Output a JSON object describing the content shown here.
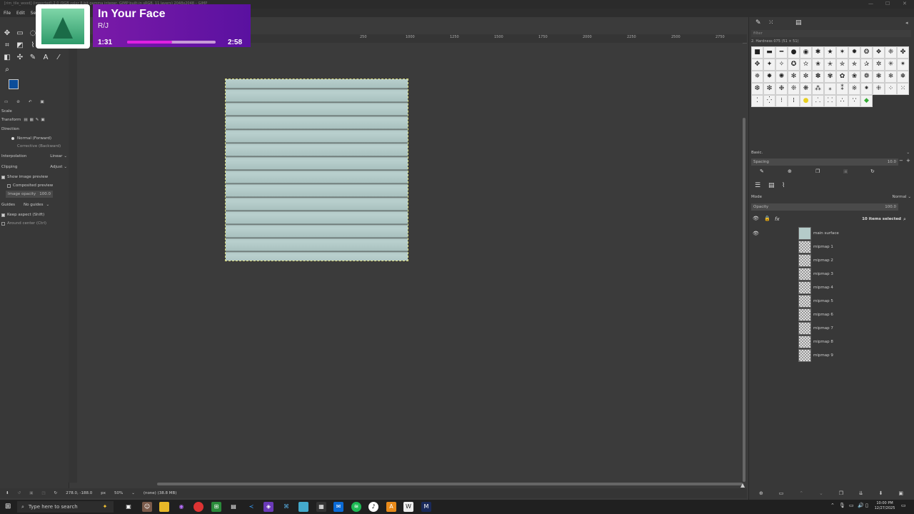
{
  "window": {
    "title": "[rim_tile_wood] (imported)-2.0 (RGB color 8-bit gamma integer, GIMP built-in sRGB, 11 layers) 2048x2048 – GIMP"
  },
  "menu": [
    "File",
    "Edit",
    "Select"
  ],
  "tool_options": {
    "title": "Scale",
    "transform_label": "Transform",
    "direction_label": "Direction",
    "direction_options": [
      "Normal (Forward)",
      "Corrective (Backward)"
    ],
    "interpolation_label": "Interpolation",
    "interpolation_value": "Linear",
    "clipping_label": "Clipping",
    "clipping_value": "Adjust",
    "show_preview": "Show image preview",
    "composited_preview": "Composited preview",
    "image_opacity_label": "Image opacity",
    "image_opacity_value": "100.0",
    "guides_label": "Guides",
    "guides_value": "No guides",
    "keep_aspect": "Keep aspect (Shift)",
    "around_center": "Around center (Ctrl)"
  },
  "status": {
    "coords": "278.0, -188.0",
    "unit": "px",
    "zoom": "50%",
    "info": "(none) (38.8 MB)"
  },
  "ruler_marks": [
    "250",
    "500",
    "750",
    "1000",
    "1250",
    "1500",
    "1750",
    "2000",
    "2250",
    "2500",
    "2750"
  ],
  "brushes": {
    "filter_placeholder": "filter",
    "current_brush": "2. Hardness 075 (51 × 51)",
    "preset": "Basic.",
    "spacing_label": "Spacing",
    "spacing_value": "10.0"
  },
  "layers": {
    "mode_label": "Mode",
    "mode_value": "Normal",
    "opacity_label": "Opacity",
    "opacity_value": "100.0",
    "selected_count": "10 items selected",
    "items": [
      "main surface",
      "mipmap 1",
      "mipmap 2",
      "mipmap 3",
      "mipmap 4",
      "mipmap 5",
      "mipmap 6",
      "mipmap 7",
      "mipmap 8",
      "mipmap 9"
    ]
  },
  "now_playing": {
    "title": "In Your Face",
    "artist": "R/J",
    "elapsed": "1:31",
    "total": "2:58",
    "progress": 0.51,
    "accent_color": "#e020e0"
  },
  "taskbar": {
    "search_placeholder": "Type here to search",
    "time": "10:00 PM",
    "date": "12/27/2025"
  }
}
